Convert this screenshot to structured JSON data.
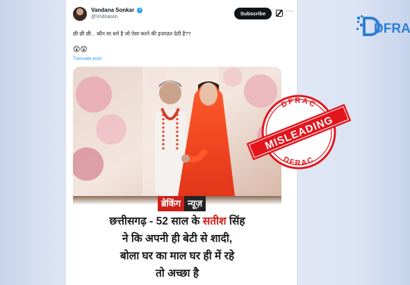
{
  "tweet": {
    "author_name": "Vandana Sonkar",
    "verified_mark": "✔",
    "handle": "@Vndnason",
    "subscribe_label": "Subscribe",
    "more_label": "···",
    "text": "छी छी छी... कौन सा धर्म है जो ऐसा करने की इजाज़त देती है??",
    "emojis": "😲😲",
    "translate_label": "Translate post"
  },
  "media": {
    "breaking_part1": "ब्रेकिंग",
    "breaking_part2": "न्यूज़",
    "headline_line1_pre": "छत्तीसगढ़ - 52 साल के ",
    "headline_line1_name": "सतीश",
    "headline_line1_post": " सिंह",
    "headline_line2": "ने कि अपनी ही बेटी से शादी,",
    "headline_line3": "बोला घर का माल घर ही में रहे",
    "headline_line4": "तो अच्छा है"
  },
  "stamp": {
    "top_text": "DFRAC",
    "bottom_text": "DFRAC",
    "label": "MISLEADING",
    "color": "#e3151c"
  },
  "logo": {
    "text": "DFRA",
    "brand_color": "#2c7fd6"
  }
}
